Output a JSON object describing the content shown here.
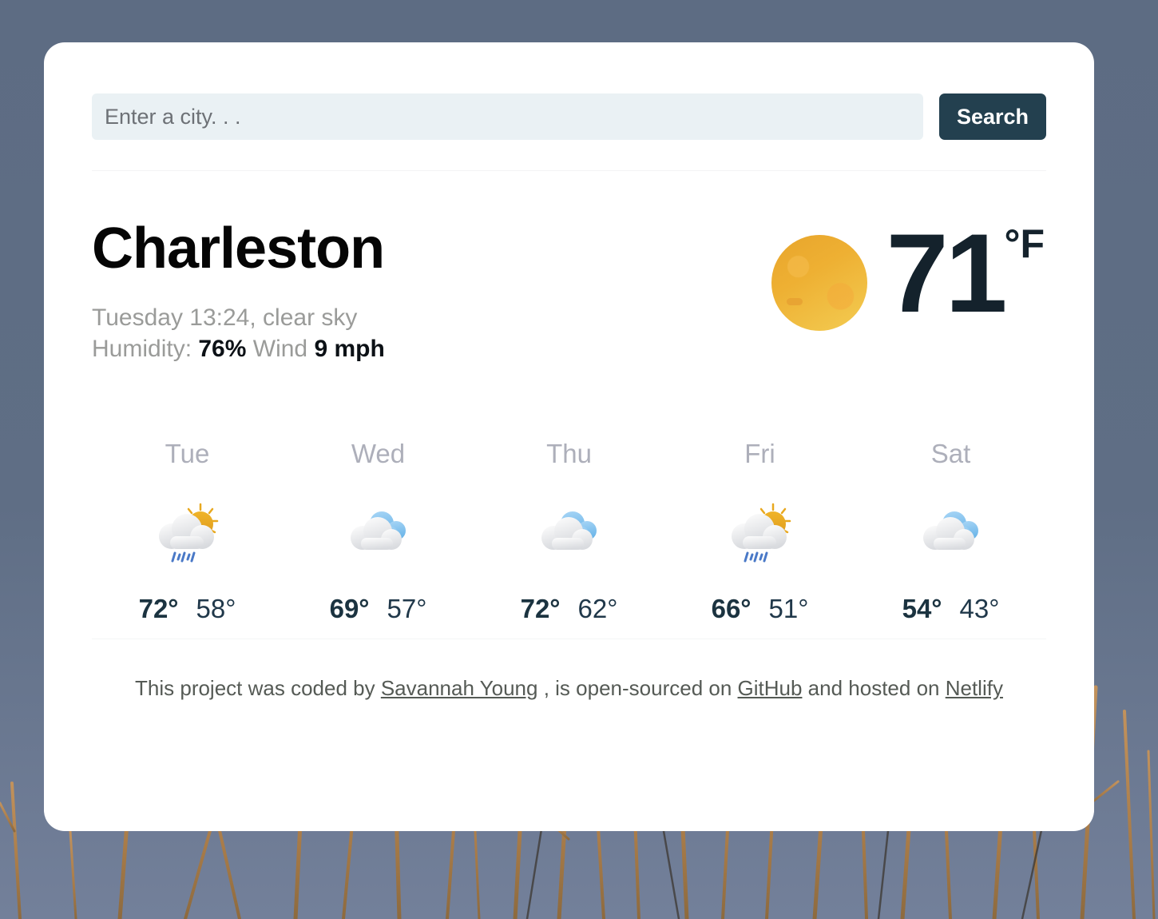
{
  "search": {
    "placeholder": "Enter a city. . .",
    "value": "",
    "button_label": "Search"
  },
  "current": {
    "city": "Charleston",
    "conditions": "Tuesday 13:24, clear sky",
    "humidity_label": "Humidity:",
    "humidity_value": "76%",
    "wind_label": "Wind",
    "wind_value": "9 mph",
    "temperature": "71",
    "unit": "°F",
    "icon": "sun-icon"
  },
  "forecast": [
    {
      "day": "Tue",
      "icon": "sun-cloud-rain-icon",
      "max": "72°",
      "min": "58°"
    },
    {
      "day": "Wed",
      "icon": "broken-clouds-icon",
      "max": "69°",
      "min": "57°"
    },
    {
      "day": "Thu",
      "icon": "broken-clouds-icon",
      "max": "72°",
      "min": "62°"
    },
    {
      "day": "Fri",
      "icon": "sun-cloud-rain-icon",
      "max": "66°",
      "min": "51°"
    },
    {
      "day": "Sat",
      "icon": "broken-clouds-icon",
      "max": "54°",
      "min": "43°"
    }
  ],
  "footer": {
    "text_1": "This project was coded by ",
    "link_author": "Savannah Young",
    "text_2": " , is open-sourced on ",
    "link_github": "GitHub",
    "text_3": " and hosted on ",
    "link_netlify": "Netlify"
  },
  "colors": {
    "page_background": "#5d6c83",
    "card_background": "#ffffff",
    "search_button": "#23404f",
    "search_input_background": "#eaf1f4",
    "accent_sun": "#eeb033",
    "accent_cloud_blue": "#8dc4ec",
    "temp_text": "#14222c",
    "muted_text": "#9a9b99"
  }
}
